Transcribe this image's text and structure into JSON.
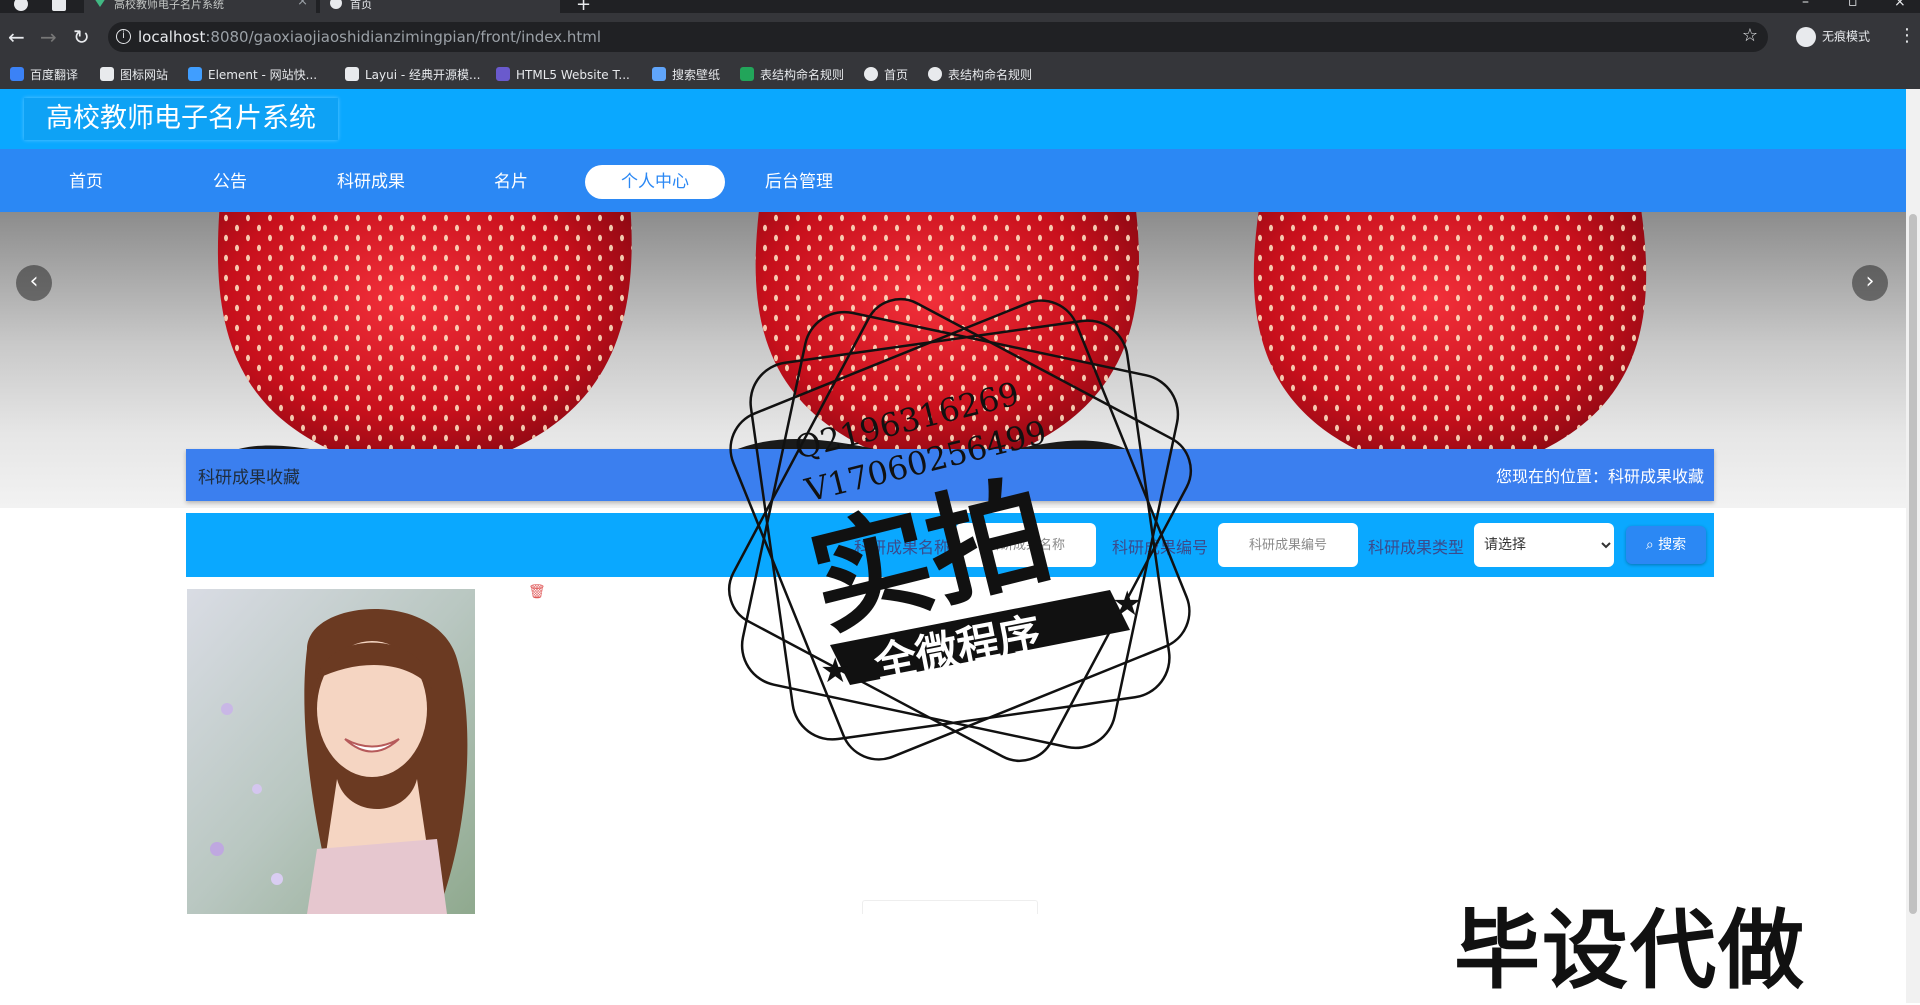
{
  "browser": {
    "tabs": [
      {
        "title": "高校教师电子名片系统",
        "active": false
      },
      {
        "title": "首页",
        "active": true
      }
    ],
    "url_host": "localhost",
    "url_path": ":8080/gaoxiaojiaoshidianzimingpian/front/index.html",
    "incognito_label": "无痕模式",
    "bookmarks": [
      {
        "label": "百度翻译",
        "icon": "translate-icon",
        "color": "#3b82f6"
      },
      {
        "label": "图标网站",
        "icon": "flag-icon",
        "color": "#e8eaed"
      },
      {
        "label": "Element - 网站快...",
        "icon": "element-icon",
        "color": "#409eff"
      },
      {
        "label": "Layui - 经典开源模...",
        "icon": "layui-icon",
        "color": "#e8eaed"
      },
      {
        "label": "HTML5 Website T...",
        "icon": "html5-icon",
        "color": "#6a5acd"
      },
      {
        "label": "搜索壁纸",
        "icon": "wallpaper-icon",
        "color": "#60a5fa"
      },
      {
        "label": "表结构命名规则",
        "icon": "sheet-icon",
        "color": "#22a55a"
      },
      {
        "label": "首页",
        "icon": "globe-icon",
        "color": "#e8eaed"
      },
      {
        "label": "表结构命名规则",
        "icon": "globe-icon",
        "color": "#e8eaed"
      }
    ]
  },
  "site": {
    "title": "高校教师电子名片系统",
    "colors": {
      "header": "#0aa8ff",
      "nav": "#2b88f4",
      "title_bar": "#3b7fef"
    }
  },
  "nav": {
    "items": [
      {
        "label": "首页",
        "active": false
      },
      {
        "label": "公告",
        "active": false
      },
      {
        "label": "科研成果",
        "active": false
      },
      {
        "label": "名片",
        "active": false
      },
      {
        "label": "个人中心",
        "active": true
      },
      {
        "label": "后台管理",
        "active": false
      }
    ]
  },
  "banner": {
    "prev_icon": "chevron-left-icon",
    "next_icon": "chevron-right-icon"
  },
  "section": {
    "title": "科研成果收藏",
    "location_prefix": "您现在的位置：",
    "location": "科研成果收藏"
  },
  "search": {
    "name_label": "科研成果名称",
    "name_placeholder": "科研成果名称",
    "code_label": "科研成果编号",
    "code_placeholder": "科研成果编号",
    "type_label": "科研成果类型",
    "type_selected": "请选择",
    "button_label": "搜索"
  },
  "watermark": {
    "qq": "Q2196316269",
    "vx": "V17060256499",
    "stamp_main": "实拍",
    "stamp_banner": "全微程序",
    "corner_text": "毕设代做"
  }
}
